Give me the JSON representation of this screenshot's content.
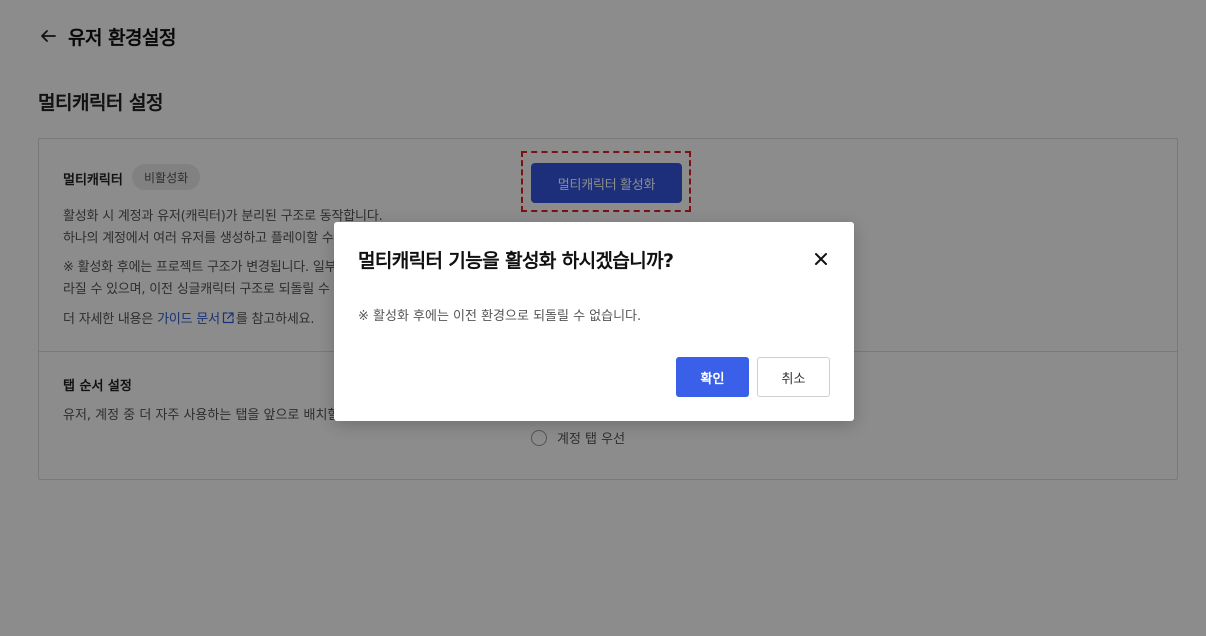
{
  "header": {
    "title": "유저 환경설정"
  },
  "section": {
    "title": "멀티캐릭터 설정"
  },
  "multichar": {
    "label": "멀티캐릭터",
    "status_badge": "비활성화",
    "desc_line1": "활성화 시 계정과 유저(캐릭터)가 분리된 구조로 동작합니다.",
    "desc_line2": "하나의 계정에서 여러 유저를 생성하고 플레이할 수",
    "note_line1": "※ 활성화 후에는 프로젝트 구조가 변경됩니다. 일부",
    "note_line2": "라질 수 있으며, 이전 싱글캐릭터 구조로 되돌릴 수",
    "more_prefix": "더 자세한 내용은 ",
    "guide_link": "가이드 문서",
    "more_suffix": "를 참고하세요.",
    "activate_button": "멀티캐릭터 활성화"
  },
  "tab_order": {
    "label": "탭 순서 설정",
    "desc": "유저, 계정 중 더 자주 사용하는 탭을 앞으로 배치할",
    "option_account": "계정 탭 우선"
  },
  "modal": {
    "title": "멀티캐릭터 기능을 활성화 하시겠습니까?",
    "note": "※ 활성화 후에는 이전 환경으로 되돌릴 수 없습니다.",
    "confirm_label": "확인",
    "cancel_label": "취소"
  },
  "colors": {
    "primary": "#3a5fe8",
    "focus_outline": "#e02020",
    "overlay": "rgba(0,0,0,0.45)"
  },
  "icons": {
    "back": "arrow-left-icon",
    "external": "external-link-icon",
    "close": "close-icon"
  }
}
